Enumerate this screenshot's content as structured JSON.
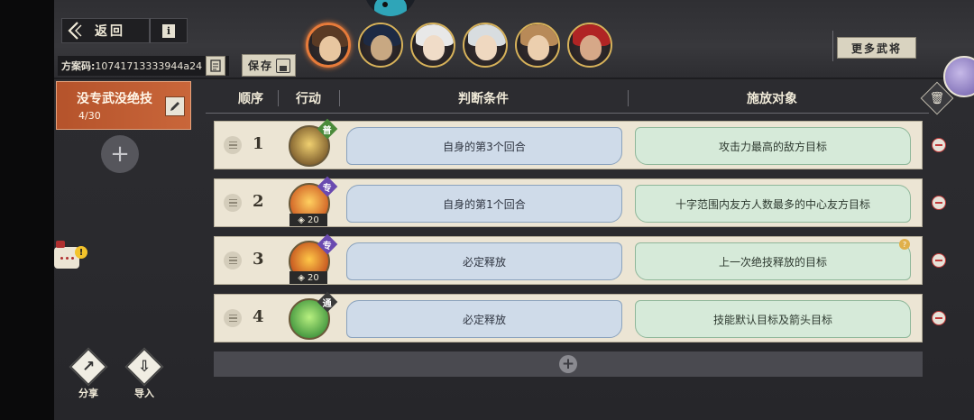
{
  "header": {
    "back_label": "返回",
    "info_icon": "info-icon",
    "code_label": "方案码:",
    "code_value": "10741713333944a24",
    "save_label": "保存",
    "more_label": "更多武将"
  },
  "heroes": [
    {
      "name": "hero-1",
      "selected": true,
      "hair": "#5a3a24",
      "face": "#e8c6a0"
    },
    {
      "name": "hero-2",
      "selected": false,
      "hair": "#1d2a44",
      "face": "#c8a882"
    },
    {
      "name": "hero-3",
      "selected": false,
      "hair": "#e8e8e8",
      "face": "#f0dcc8"
    },
    {
      "name": "hero-4",
      "selected": false,
      "hair": "#d8dde0",
      "face": "#efd8c0"
    },
    {
      "name": "hero-5",
      "selected": false,
      "hair": "#b88a58",
      "face": "#eccfae"
    },
    {
      "name": "hero-6",
      "selected": false,
      "hair": "#b02424",
      "face": "#d6a888"
    }
  ],
  "preset": {
    "name": "没专武没绝技",
    "count": "4/30"
  },
  "left_actions": {
    "share_label": "分享",
    "import_label": "导入",
    "notice_count": "!"
  },
  "table": {
    "headers": [
      "顺序",
      "行动",
      "判断条件",
      "施放对象"
    ],
    "rows": [
      {
        "order": "1",
        "badge": "普",
        "badge_color": "#4a8a3a",
        "cost": "",
        "condition": "自身的第3个回合",
        "target": "攻击力最高的敌方目标",
        "skill_colors": [
          "#f0d070",
          "#5a3a18"
        ],
        "hint": false
      },
      {
        "order": "2",
        "badge": "专",
        "badge_color": "#6a4ab0",
        "cost": "20",
        "condition": "自身的第1个回合",
        "target": "十字范围内友方人数最多的中心友方目标",
        "skill_colors": [
          "#ffd060",
          "#c03a10"
        ],
        "hint": false
      },
      {
        "order": "3",
        "badge": "专",
        "badge_color": "#6a4ab0",
        "cost": "20",
        "condition": "必定释放",
        "target": "上一次绝技释放的目标",
        "skill_colors": [
          "#ffc848",
          "#b02a10"
        ],
        "hint": true
      },
      {
        "order": "4",
        "badge": "通",
        "badge_color": "#3a3a3a",
        "cost": "",
        "condition": "必定释放",
        "target": "技能默认目标及箭头目标",
        "skill_colors": [
          "#b8f080",
          "#1e7a2a"
        ],
        "hint": false
      }
    ]
  },
  "colors": {
    "accent_orange": "#c9663a",
    "condition_blue": "#cfdbe9",
    "target_green": "#d6ead9",
    "remove_red": "#c23a3a"
  }
}
